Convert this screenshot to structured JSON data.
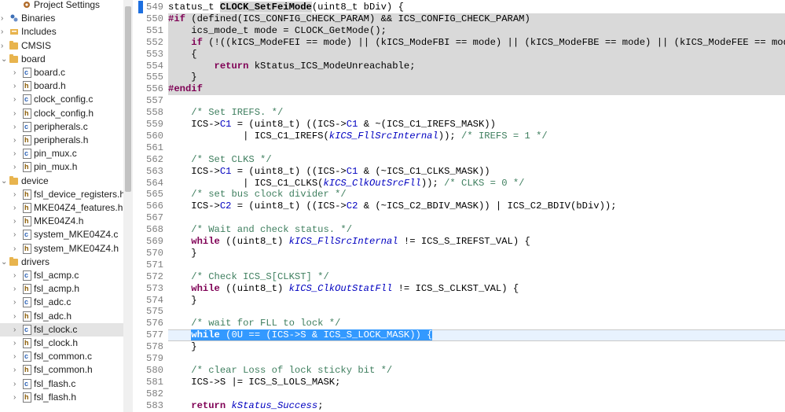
{
  "project_tree": {
    "items": [
      {
        "label": "Project Settings",
        "icon": "settings-icon",
        "indent": 1,
        "twisty": ""
      },
      {
        "label": "Binaries",
        "icon": "binaries-icon",
        "indent": 0,
        "twisty": ">"
      },
      {
        "label": "Includes",
        "icon": "includes-icon",
        "indent": 0,
        "twisty": ">"
      },
      {
        "label": "CMSIS",
        "icon": "folder-icon",
        "indent": 0,
        "twisty": ">"
      },
      {
        "label": "board",
        "icon": "folder-icon",
        "indent": 0,
        "twisty": "v"
      },
      {
        "label": "board.c",
        "icon": "c-file-icon",
        "indent": 1,
        "twisty": ">"
      },
      {
        "label": "board.h",
        "icon": "h-file-icon",
        "indent": 1,
        "twisty": ">"
      },
      {
        "label": "clock_config.c",
        "icon": "c-file-icon",
        "indent": 1,
        "twisty": ">"
      },
      {
        "label": "clock_config.h",
        "icon": "h-file-icon",
        "indent": 1,
        "twisty": ">"
      },
      {
        "label": "peripherals.c",
        "icon": "c-file-icon",
        "indent": 1,
        "twisty": ">"
      },
      {
        "label": "peripherals.h",
        "icon": "h-file-icon",
        "indent": 1,
        "twisty": ">"
      },
      {
        "label": "pin_mux.c",
        "icon": "c-file-icon",
        "indent": 1,
        "twisty": ">"
      },
      {
        "label": "pin_mux.h",
        "icon": "h-file-icon",
        "indent": 1,
        "twisty": ">"
      },
      {
        "label": "device",
        "icon": "folder-icon",
        "indent": 0,
        "twisty": "v"
      },
      {
        "label": "fsl_device_registers.h",
        "icon": "h-file-icon",
        "indent": 1,
        "twisty": ">"
      },
      {
        "label": "MKE04Z4_features.h",
        "icon": "h-file-icon",
        "indent": 1,
        "twisty": ">"
      },
      {
        "label": "MKE04Z4.h",
        "icon": "h-file-icon",
        "indent": 1,
        "twisty": ">"
      },
      {
        "label": "system_MKE04Z4.c",
        "icon": "c-file-icon",
        "indent": 1,
        "twisty": ">"
      },
      {
        "label": "system_MKE04Z4.h",
        "icon": "h-file-icon",
        "indent": 1,
        "twisty": ">"
      },
      {
        "label": "drivers",
        "icon": "folder-icon",
        "indent": 0,
        "twisty": "v"
      },
      {
        "label": "fsl_acmp.c",
        "icon": "c-file-icon",
        "indent": 1,
        "twisty": ">"
      },
      {
        "label": "fsl_acmp.h",
        "icon": "h-file-icon",
        "indent": 1,
        "twisty": ">"
      },
      {
        "label": "fsl_adc.c",
        "icon": "c-file-icon",
        "indent": 1,
        "twisty": ">"
      },
      {
        "label": "fsl_adc.h",
        "icon": "h-file-icon",
        "indent": 1,
        "twisty": ">"
      },
      {
        "label": "fsl_clock.c",
        "icon": "c-file-icon",
        "indent": 1,
        "twisty": ">",
        "selected": true
      },
      {
        "label": "fsl_clock.h",
        "icon": "h-file-icon",
        "indent": 1,
        "twisty": ">"
      },
      {
        "label": "fsl_common.c",
        "icon": "c-file-icon",
        "indent": 1,
        "twisty": ">"
      },
      {
        "label": "fsl_common.h",
        "icon": "h-file-icon",
        "indent": 1,
        "twisty": ">"
      },
      {
        "label": "fsl_flash.c",
        "icon": "c-file-icon",
        "indent": 1,
        "twisty": ">"
      },
      {
        "label": "fsl_flash.h",
        "icon": "h-file-icon",
        "indent": 1,
        "twisty": ">"
      }
    ]
  },
  "editor": {
    "lines": [
      {
        "n": "549",
        "style": "",
        "toks": [
          [
            "",
            "status_t "
          ],
          [
            "fnd",
            "CLOCK_SetFeiMode"
          ],
          [
            "",
            "(uint8_t bDiv) {"
          ]
        ]
      },
      {
        "n": "550",
        "style": "inactive",
        "toks": [
          [
            "pp",
            "#if"
          ],
          [
            "",
            " (defined(ICS_CONFIG_CHECK_PARAM) && ICS_CONFIG_CHECK_PARAM)"
          ]
        ]
      },
      {
        "n": "551",
        "style": "inactive",
        "toks": [
          [
            "",
            "    ics_mode_t mode = CLOCK_GetMode();"
          ]
        ]
      },
      {
        "n": "552",
        "style": "inactive",
        "toks": [
          [
            "",
            "    "
          ],
          [
            "kw",
            "if"
          ],
          [
            "",
            " (!((kICS_ModeFEI == mode) || (kICS_ModeFBI == mode) || (kICS_ModeFBE == mode) || (kICS_ModeFEE == mode)))"
          ]
        ]
      },
      {
        "n": "553",
        "style": "inactive",
        "toks": [
          [
            "",
            "    {"
          ]
        ]
      },
      {
        "n": "554",
        "style": "inactive",
        "toks": [
          [
            "",
            "        "
          ],
          [
            "kw",
            "return"
          ],
          [
            "",
            " kStatus_ICS_ModeUnreachable;"
          ]
        ]
      },
      {
        "n": "555",
        "style": "inactive",
        "toks": [
          [
            "",
            "    }"
          ]
        ]
      },
      {
        "n": "556",
        "style": "inactive",
        "toks": [
          [
            "pp",
            "#endif"
          ]
        ]
      },
      {
        "n": "557",
        "style": "",
        "toks": [
          [
            "",
            ""
          ]
        ]
      },
      {
        "n": "558",
        "style": "",
        "toks": [
          [
            "",
            "    "
          ],
          [
            "cm",
            "/* Set IREFS. */"
          ]
        ]
      },
      {
        "n": "559",
        "style": "",
        "toks": [
          [
            "",
            "    ICS->"
          ],
          [
            "fld",
            "C1"
          ],
          [
            "",
            " = (uint8_t) ((ICS->"
          ],
          [
            "fld",
            "C1"
          ],
          [
            "",
            " & ~(ICS_C1_IREFS_MASK))"
          ]
        ]
      },
      {
        "n": "560",
        "style": "",
        "toks": [
          [
            "",
            "             | ICS_C1_IREFS("
          ],
          [
            "en",
            "kICS_FllSrcInternal"
          ],
          [
            "",
            "));"
          ],
          [
            "cm",
            " /* IREFS = 1 */"
          ]
        ]
      },
      {
        "n": "561",
        "style": "",
        "toks": [
          [
            "",
            ""
          ]
        ]
      },
      {
        "n": "562",
        "style": "",
        "toks": [
          [
            "",
            "    "
          ],
          [
            "cm",
            "/* Set CLKS */"
          ]
        ]
      },
      {
        "n": "563",
        "style": "",
        "toks": [
          [
            "",
            "    ICS->"
          ],
          [
            "fld",
            "C1"
          ],
          [
            "",
            " = (uint8_t) ((ICS->"
          ],
          [
            "fld",
            "C1"
          ],
          [
            "",
            " & (~ICS_C1_CLKS_MASK))"
          ]
        ]
      },
      {
        "n": "564",
        "style": "",
        "toks": [
          [
            "",
            "             | ICS_C1_CLKS("
          ],
          [
            "en",
            "kICS_ClkOutSrcFll"
          ],
          [
            "",
            "));"
          ],
          [
            "cm",
            " /* CLKS = 0 */"
          ]
        ]
      },
      {
        "n": "565",
        "style": "",
        "toks": [
          [
            "",
            "    "
          ],
          [
            "cm",
            "/* set bus clock divider */"
          ]
        ]
      },
      {
        "n": "566",
        "style": "",
        "toks": [
          [
            "",
            "    ICS->"
          ],
          [
            "fld",
            "C2"
          ],
          [
            "",
            " = (uint8_t) ((ICS->"
          ],
          [
            "fld",
            "C2"
          ],
          [
            "",
            " & (~ICS_C2_BDIV_MASK)) | ICS_C2_BDIV(bDiv));"
          ]
        ]
      },
      {
        "n": "567",
        "style": "",
        "toks": [
          [
            "",
            ""
          ]
        ]
      },
      {
        "n": "568",
        "style": "",
        "toks": [
          [
            "",
            "    "
          ],
          [
            "cm",
            "/* Wait and check status. */"
          ]
        ]
      },
      {
        "n": "569",
        "style": "",
        "toks": [
          [
            "",
            "    "
          ],
          [
            "kw",
            "while"
          ],
          [
            "",
            " ((uint8_t) "
          ],
          [
            "en",
            "kICS_FllSrcInternal"
          ],
          [
            "",
            " != ICS_S_IREFST_VAL) {"
          ]
        ]
      },
      {
        "n": "570",
        "style": "",
        "toks": [
          [
            "",
            "    }"
          ]
        ]
      },
      {
        "n": "571",
        "style": "",
        "toks": [
          [
            "",
            ""
          ]
        ]
      },
      {
        "n": "572",
        "style": "",
        "toks": [
          [
            "",
            "    "
          ],
          [
            "cm",
            "/* Check ICS_S[CLKST] */"
          ]
        ]
      },
      {
        "n": "573",
        "style": "",
        "toks": [
          [
            "",
            "    "
          ],
          [
            "kw",
            "while"
          ],
          [
            "",
            " ((uint8_t) "
          ],
          [
            "en",
            "kICS_ClkOutStatFll"
          ],
          [
            "",
            " != ICS_S_CLKST_VAL) {"
          ]
        ]
      },
      {
        "n": "574",
        "style": "",
        "toks": [
          [
            "",
            "    }"
          ]
        ]
      },
      {
        "n": "575",
        "style": "",
        "toks": [
          [
            "",
            ""
          ]
        ]
      },
      {
        "n": "576",
        "style": "",
        "toks": [
          [
            "",
            "    "
          ],
          [
            "cm",
            "/* wait for FLL to lock */"
          ]
        ]
      },
      {
        "n": "577",
        "style": "cur",
        "toks": [
          [
            "",
            "    "
          ],
          [
            "selc kw",
            "while"
          ],
          [
            "selc",
            " (0U == (ICS->S & ICS_S_LOCK_MASK)) {"
          ]
        ]
      },
      {
        "n": "578",
        "style": "",
        "toks": [
          [
            "",
            "    }"
          ]
        ]
      },
      {
        "n": "579",
        "style": "",
        "toks": [
          [
            "",
            ""
          ]
        ]
      },
      {
        "n": "580",
        "style": "",
        "toks": [
          [
            "",
            "    "
          ],
          [
            "cm",
            "/* clear Loss of lock sticky bit */"
          ]
        ]
      },
      {
        "n": "581",
        "style": "",
        "toks": [
          [
            "",
            "    ICS->S |= ICS_S_LOLS_MASK;"
          ]
        ]
      },
      {
        "n": "582",
        "style": "",
        "toks": [
          [
            "",
            ""
          ]
        ]
      },
      {
        "n": "583",
        "style": "",
        "toks": [
          [
            "",
            "    "
          ],
          [
            "kw",
            "return"
          ],
          [
            "",
            " "
          ],
          [
            "en",
            "kStatus_Success"
          ],
          [
            "",
            ";"
          ]
        ]
      }
    ]
  },
  "colors": {
    "keyword": "#7f0055",
    "comment": "#3f7f5f",
    "enum": "#0000c0",
    "inactive_bg": "#d9d9d9",
    "selection": "#3399ff"
  }
}
